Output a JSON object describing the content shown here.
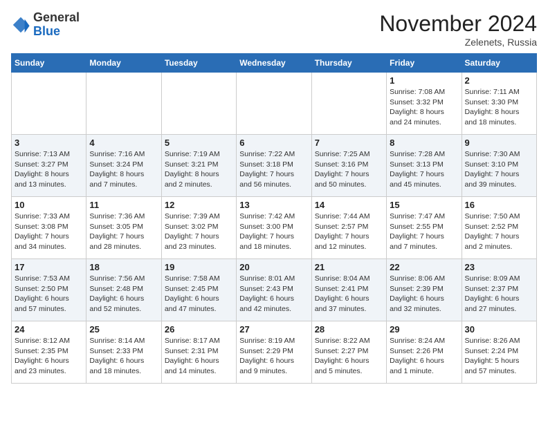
{
  "logo": {
    "general": "General",
    "blue": "Blue"
  },
  "header": {
    "month": "November 2024",
    "location": "Zelenets, Russia"
  },
  "weekdays": [
    "Sunday",
    "Monday",
    "Tuesday",
    "Wednesday",
    "Thursday",
    "Friday",
    "Saturday"
  ],
  "weeks": [
    [
      {
        "day": "",
        "info": ""
      },
      {
        "day": "",
        "info": ""
      },
      {
        "day": "",
        "info": ""
      },
      {
        "day": "",
        "info": ""
      },
      {
        "day": "",
        "info": ""
      },
      {
        "day": "1",
        "info": "Sunrise: 7:08 AM\nSunset: 3:32 PM\nDaylight: 8 hours\nand 24 minutes."
      },
      {
        "day": "2",
        "info": "Sunrise: 7:11 AM\nSunset: 3:30 PM\nDaylight: 8 hours\nand 18 minutes."
      }
    ],
    [
      {
        "day": "3",
        "info": "Sunrise: 7:13 AM\nSunset: 3:27 PM\nDaylight: 8 hours\nand 13 minutes."
      },
      {
        "day": "4",
        "info": "Sunrise: 7:16 AM\nSunset: 3:24 PM\nDaylight: 8 hours\nand 7 minutes."
      },
      {
        "day": "5",
        "info": "Sunrise: 7:19 AM\nSunset: 3:21 PM\nDaylight: 8 hours\nand 2 minutes."
      },
      {
        "day": "6",
        "info": "Sunrise: 7:22 AM\nSunset: 3:18 PM\nDaylight: 7 hours\nand 56 minutes."
      },
      {
        "day": "7",
        "info": "Sunrise: 7:25 AM\nSunset: 3:16 PM\nDaylight: 7 hours\nand 50 minutes."
      },
      {
        "day": "8",
        "info": "Sunrise: 7:28 AM\nSunset: 3:13 PM\nDaylight: 7 hours\nand 45 minutes."
      },
      {
        "day": "9",
        "info": "Sunrise: 7:30 AM\nSunset: 3:10 PM\nDaylight: 7 hours\nand 39 minutes."
      }
    ],
    [
      {
        "day": "10",
        "info": "Sunrise: 7:33 AM\nSunset: 3:08 PM\nDaylight: 7 hours\nand 34 minutes."
      },
      {
        "day": "11",
        "info": "Sunrise: 7:36 AM\nSunset: 3:05 PM\nDaylight: 7 hours\nand 28 minutes."
      },
      {
        "day": "12",
        "info": "Sunrise: 7:39 AM\nSunset: 3:02 PM\nDaylight: 7 hours\nand 23 minutes."
      },
      {
        "day": "13",
        "info": "Sunrise: 7:42 AM\nSunset: 3:00 PM\nDaylight: 7 hours\nand 18 minutes."
      },
      {
        "day": "14",
        "info": "Sunrise: 7:44 AM\nSunset: 2:57 PM\nDaylight: 7 hours\nand 12 minutes."
      },
      {
        "day": "15",
        "info": "Sunrise: 7:47 AM\nSunset: 2:55 PM\nDaylight: 7 hours\nand 7 minutes."
      },
      {
        "day": "16",
        "info": "Sunrise: 7:50 AM\nSunset: 2:52 PM\nDaylight: 7 hours\nand 2 minutes."
      }
    ],
    [
      {
        "day": "17",
        "info": "Sunrise: 7:53 AM\nSunset: 2:50 PM\nDaylight: 6 hours\nand 57 minutes."
      },
      {
        "day": "18",
        "info": "Sunrise: 7:56 AM\nSunset: 2:48 PM\nDaylight: 6 hours\nand 52 minutes."
      },
      {
        "day": "19",
        "info": "Sunrise: 7:58 AM\nSunset: 2:45 PM\nDaylight: 6 hours\nand 47 minutes."
      },
      {
        "day": "20",
        "info": "Sunrise: 8:01 AM\nSunset: 2:43 PM\nDaylight: 6 hours\nand 42 minutes."
      },
      {
        "day": "21",
        "info": "Sunrise: 8:04 AM\nSunset: 2:41 PM\nDaylight: 6 hours\nand 37 minutes."
      },
      {
        "day": "22",
        "info": "Sunrise: 8:06 AM\nSunset: 2:39 PM\nDaylight: 6 hours\nand 32 minutes."
      },
      {
        "day": "23",
        "info": "Sunrise: 8:09 AM\nSunset: 2:37 PM\nDaylight: 6 hours\nand 27 minutes."
      }
    ],
    [
      {
        "day": "24",
        "info": "Sunrise: 8:12 AM\nSunset: 2:35 PM\nDaylight: 6 hours\nand 23 minutes."
      },
      {
        "day": "25",
        "info": "Sunrise: 8:14 AM\nSunset: 2:33 PM\nDaylight: 6 hours\nand 18 minutes."
      },
      {
        "day": "26",
        "info": "Sunrise: 8:17 AM\nSunset: 2:31 PM\nDaylight: 6 hours\nand 14 minutes."
      },
      {
        "day": "27",
        "info": "Sunrise: 8:19 AM\nSunset: 2:29 PM\nDaylight: 6 hours\nand 9 minutes."
      },
      {
        "day": "28",
        "info": "Sunrise: 8:22 AM\nSunset: 2:27 PM\nDaylight: 6 hours\nand 5 minutes."
      },
      {
        "day": "29",
        "info": "Sunrise: 8:24 AM\nSunset: 2:26 PM\nDaylight: 6 hours\nand 1 minute."
      },
      {
        "day": "30",
        "info": "Sunrise: 8:26 AM\nSunset: 2:24 PM\nDaylight: 5 hours\nand 57 minutes."
      }
    ]
  ]
}
